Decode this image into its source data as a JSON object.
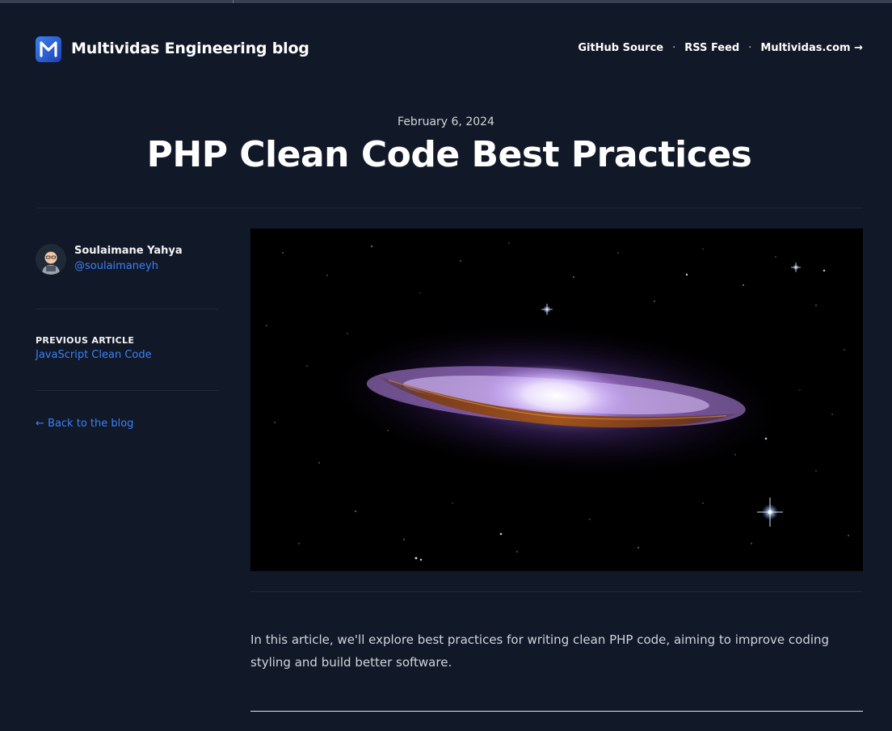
{
  "site": {
    "title": "Multividas Engineering blog",
    "logo_icon": "multividas-m-logo-icon"
  },
  "nav": {
    "items": [
      {
        "label": "GitHub Source"
      },
      {
        "label": "RSS Feed"
      },
      {
        "label": "Multividas.com →"
      }
    ],
    "separator": "·"
  },
  "article": {
    "date": "February 6, 2024",
    "title": "PHP Clean Code Best Practices",
    "intro": "In this article, we'll explore best practices for writing clean PHP code, aiming to improve coding styling and build better software.",
    "hero_icon": "galaxy-image"
  },
  "author": {
    "name": "Soulaimane Yahya",
    "handle": "@soulaimaneyh",
    "avatar_icon": "user-avatar"
  },
  "sidebar": {
    "previous_label": "PREVIOUS ARTICLE",
    "previous_title": "JavaScript Clean Code",
    "back_label": "← Back to the blog"
  },
  "colors": {
    "background": "#111827",
    "link": "#3b82f6",
    "text": "#f3f4f6",
    "muted": "#d1d5db"
  }
}
